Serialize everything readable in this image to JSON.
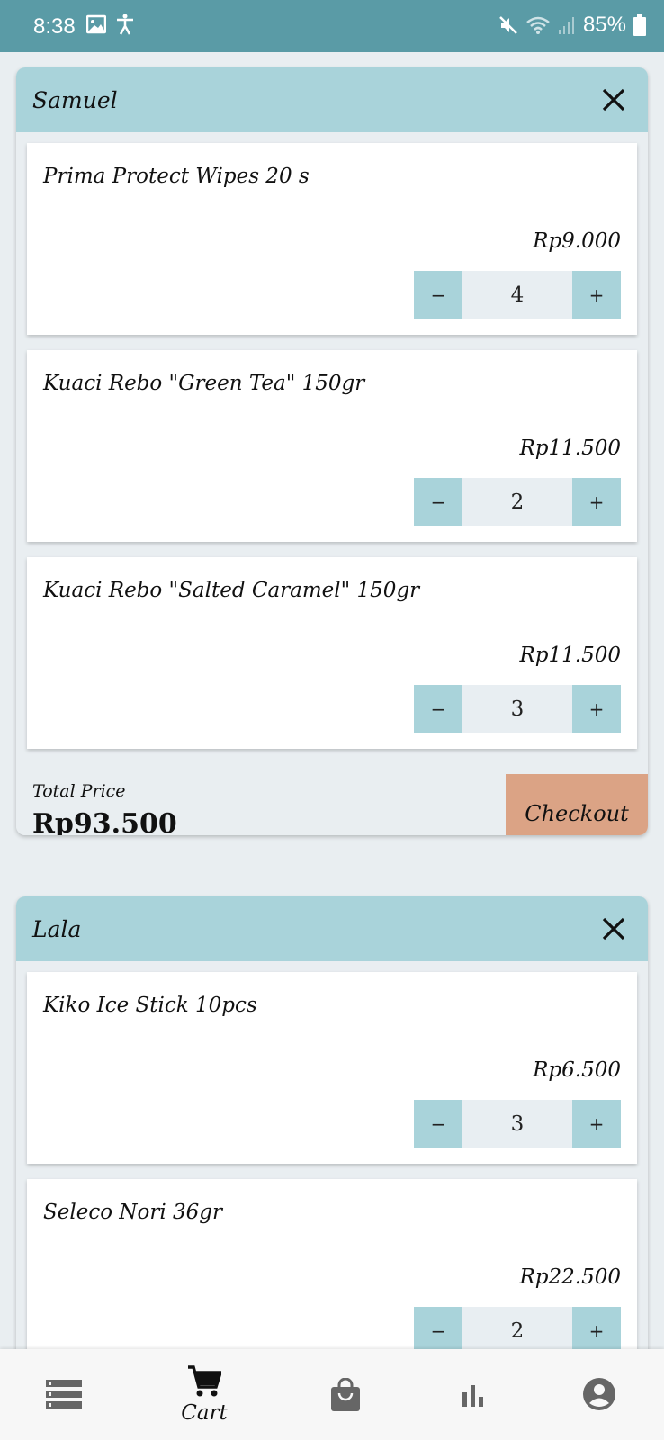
{
  "status_bar": {
    "time": "8:38",
    "battery": "85%"
  },
  "orders": [
    {
      "customer": "Samuel",
      "items": [
        {
          "name": "Prima Protect Wipes 20 s",
          "price": "Rp9.000",
          "qty": "4"
        },
        {
          "name": "Kuaci Rebo \"Green Tea\" 150gr",
          "price": "Rp11.500",
          "qty": "2"
        },
        {
          "name": "Kuaci Rebo \"Salted Caramel\" 150gr",
          "price": "Rp11.500",
          "qty": "3"
        }
      ],
      "total_label": "Total Price",
      "total": "Rp93.500",
      "checkout_label": "Checkout"
    },
    {
      "customer": "Lala",
      "items": [
        {
          "name": "Kiko Ice Stick 10pcs",
          "price": "Rp6.500",
          "qty": "3"
        },
        {
          "name": "Seleco Nori 36gr",
          "price": "Rp22.500",
          "qty": "2"
        }
      ]
    }
  ],
  "stepper": {
    "minus": "−",
    "plus": "+"
  },
  "bottom_nav": {
    "items": [
      {
        "icon": "list-icon",
        "label": ""
      },
      {
        "icon": "cart-icon",
        "label": "Cart"
      },
      {
        "icon": "shopping-bag-icon",
        "label": ""
      },
      {
        "icon": "bar-chart-icon",
        "label": ""
      },
      {
        "icon": "account-icon",
        "label": ""
      }
    ]
  },
  "colors": {
    "status_bar": "#5a9ba6",
    "header": "#a9d3da",
    "checkout": "#dba385",
    "background": "#e9eef1"
  }
}
